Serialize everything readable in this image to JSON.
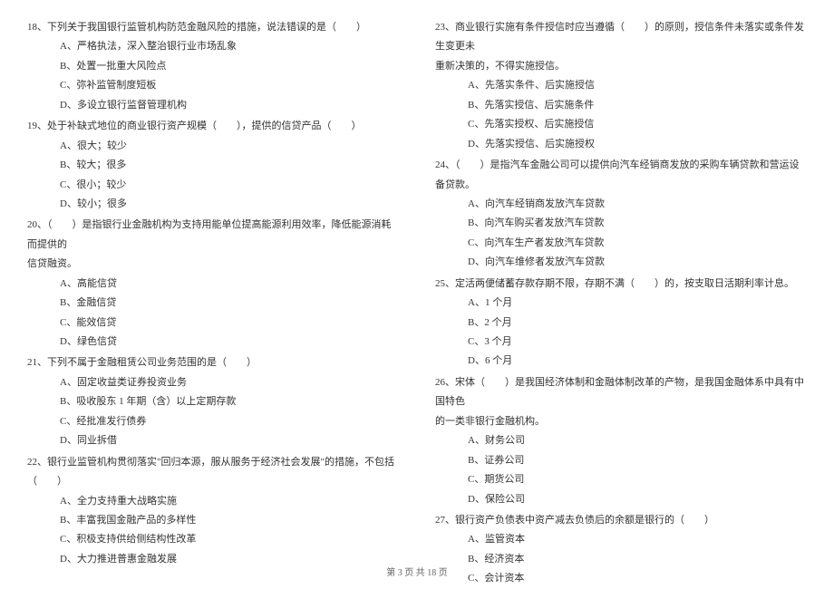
{
  "footer": "第 3 页 共 18 页",
  "left": {
    "q18": {
      "text": "18、下列关于我国银行监管机构防范金融风险的措施，说法错误的是（　　）",
      "a": "A、严格执法，深入整治银行业市场乱象",
      "b": "B、处置一批重大风险点",
      "c": "C、弥补监管制度短板",
      "d": "D、多设立银行监督管理机构"
    },
    "q19": {
      "text": "19、处于补缺式地位的商业银行资产规模（　　），提供的信贷产品（　　）",
      "a": "A、很大；较少",
      "b": "B、较大；很多",
      "c": "C、很小；较少",
      "d": "D、较小；很多"
    },
    "q20": {
      "text": "20、（　　）是指银行业金融机构为支持用能单位提高能源利用效率，降低能源消耗而提供的",
      "cont": "信贷融资。",
      "a": "A、高能信贷",
      "b": "B、金融信贷",
      "c": "C、能效信贷",
      "d": "D、绿色信贷"
    },
    "q21": {
      "text": "21、下列不属于金融租赁公司业务范围的是（　　）",
      "a": "A、固定收益类证券投资业务",
      "b": "B、吸收股东 1 年期（含）以上定期存款",
      "c": "C、经批准发行债券",
      "d": "D、同业拆借"
    },
    "q22": {
      "text": "22、银行业监管机构贯彻落实\"回归本源，服从服务于经济社会发展\"的措施，不包括（　　）",
      "a": "A、全力支持重大战略实施",
      "b": "B、丰富我国金融产品的多样性",
      "c": "C、积极支持供给侧结构性改革",
      "d": "D、大力推进普惠金融发展"
    }
  },
  "right": {
    "q23": {
      "text": "23、商业银行实施有条件授信时应当遵循（　　）的原则，授信条件未落实或条件发生变更未",
      "cont": "重新决策的，不得实施授信。",
      "a": "A、先落实条件、后实施授信",
      "b": "B、先落实授信、后实施条件",
      "c": "C、先落实授权、后实施授信",
      "d": "D、先落实授信、后实施授权"
    },
    "q24": {
      "text": "24、（　　）是指汽车金融公司可以提供向汽车经销商发放的采购车辆贷款和营运设备贷款。",
      "a": "A、向汽车经销商发放汽车贷款",
      "b": "B、向汽车购买者发放汽车贷款",
      "c": "C、向汽车生产者发放汽车贷款",
      "d": "D、向汽车维修者发放汽车贷款"
    },
    "q25": {
      "text": "25、定活两便储蓄存款存期不限，存期不满（　　）的，按支取日活期利率计息。",
      "a": "A、1 个月",
      "b": "B、2 个月",
      "c": "C、3 个月",
      "d": "D、6 个月"
    },
    "q26": {
      "text": "26、宋体（　　）是我国经济体制和金融体制改革的产物，是我国金融体系中具有中国特色",
      "cont": "的一类非银行金融机构。",
      "a": "A、财务公司",
      "b": "B、证券公司",
      "c": "C、期货公司",
      "d": "D、保险公司"
    },
    "q27": {
      "text": "27、银行资产负债表中资产减去负债后的余额是银行的（　　）",
      "a": "A、监管资本",
      "b": "B、经济资本",
      "c": "C、会计资本"
    }
  }
}
